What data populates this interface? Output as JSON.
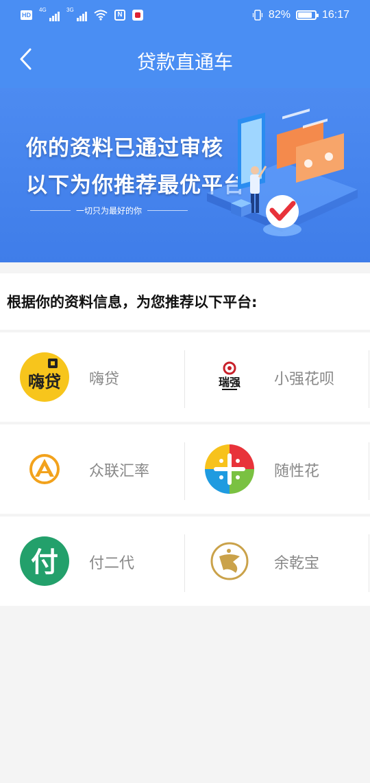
{
  "status_bar": {
    "left_badge": "HD",
    "network_1": "4G",
    "network_2": "3G",
    "battery_percent": "82%",
    "battery_level": 0.82,
    "time": "16:17",
    "icons": [
      "hd-icon",
      "signal-4g-icon",
      "signal-3g-icon",
      "wifi-icon",
      "nfc-icon",
      "app-notification-icon",
      "vibrate-icon",
      "battery-icon"
    ]
  },
  "navbar": {
    "title": "贷款直通车",
    "back_icon": "chevron-left-icon"
  },
  "banner": {
    "line1": "你的资料已通过审核",
    "line2": "以下为你推荐最优平台",
    "subtitle": "一切只为最好的你"
  },
  "section": {
    "title": "根据你的资料信息，为您推荐以下平台:"
  },
  "platforms": [
    {
      "name": "嗨贷",
      "icon": "haidai-logo-icon",
      "logo_text": "嗨贷"
    },
    {
      "name": "小强花呗",
      "icon": "xiaoqiang-logo-icon",
      "logo_text": "瑞强"
    },
    {
      "name": "众联汇率",
      "icon": "zhonglian-logo-icon"
    },
    {
      "name": "随性花",
      "icon": "suixinghua-logo-icon"
    },
    {
      "name": "付二代",
      "icon": "fuerdai-logo-icon",
      "logo_text": "付"
    },
    {
      "name": "余乾宝",
      "icon": "yuqianbao-logo-icon"
    }
  ],
  "colors": {
    "primary": "#4a8ef3",
    "banner": "#3f7de9",
    "haidai": "#f7c51c",
    "fuerdai": "#23a06b",
    "zhonglian": "#f2a21c",
    "yuqianbao": "#caa24a"
  }
}
